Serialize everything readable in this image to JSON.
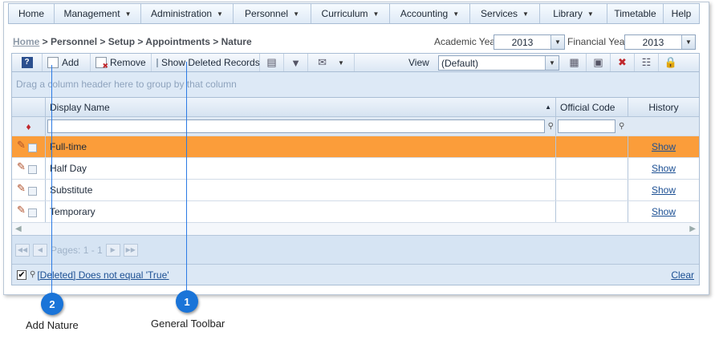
{
  "menu": {
    "items": [
      {
        "label": "Home",
        "dropdown": false
      },
      {
        "label": "Management",
        "dropdown": true
      },
      {
        "label": "Administration",
        "dropdown": true
      },
      {
        "label": "Personnel",
        "dropdown": true
      },
      {
        "label": "Curriculum",
        "dropdown": true
      },
      {
        "label": "Accounting",
        "dropdown": true
      },
      {
        "label": "Services",
        "dropdown": true
      },
      {
        "label": "Library",
        "dropdown": true
      },
      {
        "label": "Timetable",
        "dropdown": false
      },
      {
        "label": "Help",
        "dropdown": false
      }
    ]
  },
  "breadcrumb": {
    "home": "Home",
    "path": " > Personnel > Setup > Appointments > Nature"
  },
  "years": {
    "academic_label": "Academic Year",
    "academic_value": "2013",
    "financial_label": "Financial Year",
    "financial_value": "2013"
  },
  "toolbar": {
    "help_icon": "?",
    "add_label": "Add",
    "remove_label": "Remove",
    "show_deleted_label": "Show Deleted Records",
    "view_label": "View",
    "view_value": "(Default)"
  },
  "grid": {
    "group_hint": "Drag a column header here to group by that column",
    "columns": {
      "display_name": "Display Name",
      "official_code": "Official Code",
      "history": "History"
    },
    "rows": [
      {
        "display_name": "Full-time",
        "official_code": "",
        "history": "Show",
        "selected": true
      },
      {
        "display_name": "Half Day",
        "official_code": "",
        "history": "Show",
        "selected": false
      },
      {
        "display_name": "Substitute",
        "official_code": "",
        "history": "Show",
        "selected": false
      },
      {
        "display_name": "Temporary",
        "official_code": "",
        "history": "Show",
        "selected": false
      }
    ],
    "pager_text": "Pages: 1 - 1",
    "filter_text": "[Deleted] Does not equal 'True'",
    "clear_label": "Clear"
  },
  "callouts": {
    "one": {
      "number": "1",
      "label": "General Toolbar"
    },
    "two": {
      "number": "2",
      "label": "Add Nature"
    }
  },
  "colors": {
    "selected_row": "#fb9d3a",
    "badge": "#1a74d8",
    "link": "#1b4f93"
  }
}
